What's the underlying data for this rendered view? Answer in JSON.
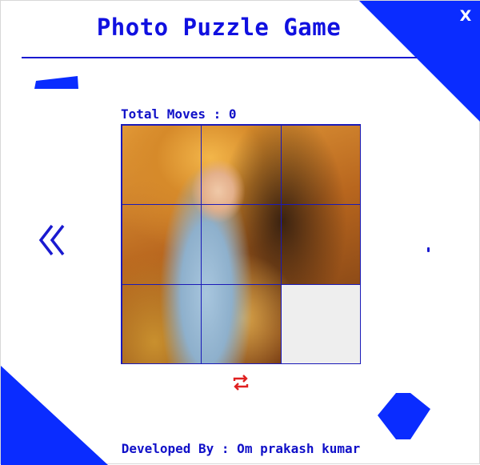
{
  "header": {
    "title": "Photo Puzzle Game",
    "close_label": "X"
  },
  "stats": {
    "moves_text": "Total Moves : 0",
    "moves_count": 0
  },
  "board": {
    "grid_size": 3,
    "tiles": [
      {
        "piece": 1,
        "empty": false
      },
      {
        "piece": 2,
        "empty": false
      },
      {
        "piece": 3,
        "empty": false
      },
      {
        "piece": 4,
        "empty": false
      },
      {
        "piece": 5,
        "empty": false
      },
      {
        "piece": 6,
        "empty": false
      },
      {
        "piece": 7,
        "empty": false
      },
      {
        "piece": 8,
        "empty": false
      },
      {
        "piece": 9,
        "empty": true
      }
    ],
    "image_description_icon": "portrait-photo"
  },
  "controls": {
    "prev_icon": "double-chevron-left-icon",
    "next_icon": "chevron-right-icon",
    "reset_icon": "shuffle-icon"
  },
  "footer": {
    "credit": "Developed By : Om prakash kumar"
  },
  "colors": {
    "accent_blue": "#1010e0",
    "shape_blue": "#0a2cff",
    "reset_red": "#e02020",
    "empty_tile": "#eeeeee"
  }
}
